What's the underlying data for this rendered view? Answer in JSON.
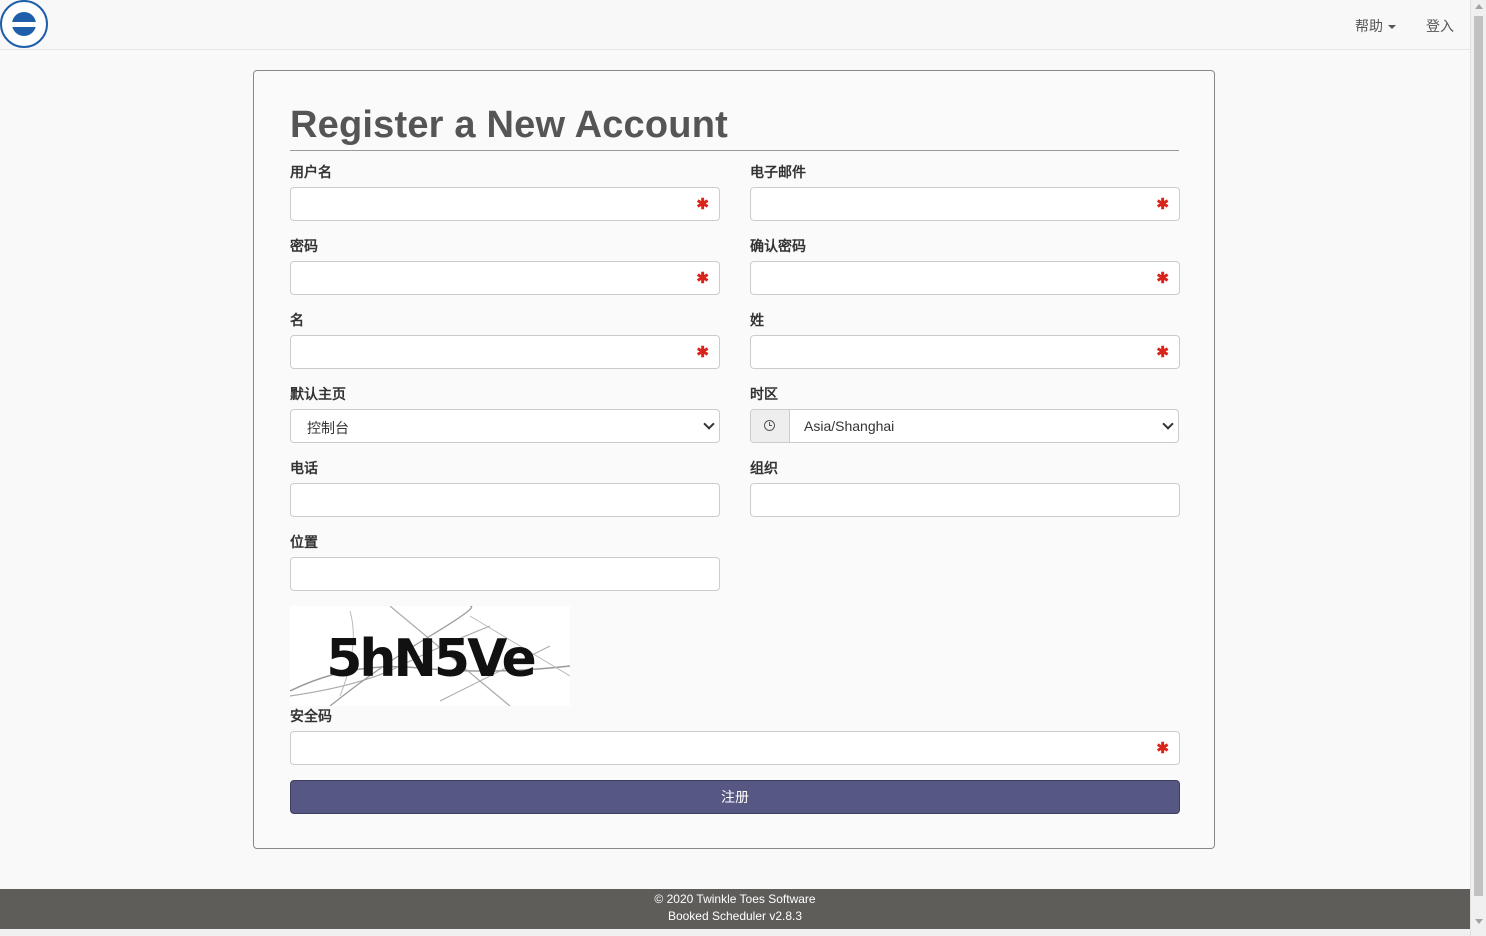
{
  "header": {
    "logo_alt": "logo",
    "help_label": "帮助",
    "login_label": "登入"
  },
  "form": {
    "title": "Register a New Account",
    "username_label": "用户名",
    "email_label": "电子邮件",
    "password_label": "密码",
    "confirm_password_label": "确认密码",
    "first_name_label": "名",
    "last_name_label": "姓",
    "homepage_label": "默认主页",
    "homepage_value": "控制台",
    "timezone_label": "时区",
    "timezone_value": "Asia/Shanghai",
    "phone_label": "电话",
    "organization_label": "组织",
    "position_label": "位置",
    "captcha_text": "5hN5Ve",
    "security_code_label": "安全码",
    "required_marker": "✱",
    "submit_label": "注册"
  },
  "footer": {
    "copyright": "© 2020 Twinkle Toes Software",
    "version": "Booked Scheduler v2.8.3"
  },
  "colors": {
    "accent_button": "#565883",
    "required": "#d9241b",
    "footer_bg": "#5e5d5a"
  }
}
